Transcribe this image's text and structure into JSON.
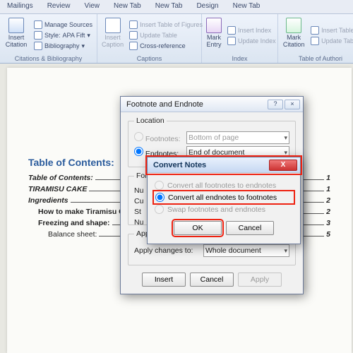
{
  "ribbon": {
    "tabs": [
      "Mailings",
      "Review",
      "View",
      "New Tab",
      "New Tab",
      "Design",
      "New Tab"
    ],
    "citations_group": {
      "insert_citation": "Insert Citation",
      "manage_sources": "Manage Sources",
      "style_label": "Style:",
      "style_value": "APA Fift",
      "bibliography": "Bibliography",
      "label": "Citations & Bibliography"
    },
    "captions_group": {
      "insert_caption": "Insert Caption",
      "tof": "Insert Table of Figures",
      "update": "Update Table",
      "crossref": "Cross-reference",
      "label": "Captions"
    },
    "index_group": {
      "mark_entry": "Mark Entry",
      "insert_index": "Insert Index",
      "update_index": "Update Index",
      "label": "Index"
    },
    "toa_group": {
      "mark_citation": "Mark Citation",
      "insert_toa": "Insert Table",
      "update_toa": "Update Table",
      "label": "Table of Authori"
    }
  },
  "document": {
    "toc_title": "Table of Contents:",
    "lines": [
      {
        "label": "Table of Contents:",
        "page": "1",
        "cls": "bold ital"
      },
      {
        "label": "TIRAMISU CAKE",
        "page": "1",
        "cls": "bold ital"
      },
      {
        "label": "Ingredients",
        "page": "2",
        "cls": "bold ital"
      },
      {
        "label": "How to make Tiramisu C",
        "page": "2",
        "cls": "bold indent1"
      },
      {
        "label": "Freezing and shape:",
        "page": "3",
        "cls": "bold indent1"
      },
      {
        "label": "Balance sheet:",
        "page": "5",
        "cls": "indent2"
      }
    ]
  },
  "dialog_footnote": {
    "title": "Footnote and Endnote",
    "location_legend": "Location",
    "footnotes_label": "Footnotes:",
    "footnotes_value": "Bottom of page",
    "endnotes_label": "Endnotes:",
    "endnotes_value": "End of document",
    "format_legend": "Form",
    "num_label": "Nu",
    "cu_label": "Cu",
    "st_label": "St",
    "nu2_label": "Nu",
    "apply_legend": "Apply changes",
    "apply_to_label": "Apply changes to:",
    "apply_to_value": "Whole document",
    "insert_btn": "Insert",
    "cancel_btn": "Cancel",
    "apply_btn": "Apply"
  },
  "dialog_convert": {
    "title": "Convert Notes",
    "opt1": "Convert all footnotes to endnotes",
    "opt2": "Convert all endnotes to footnotes",
    "opt3": "Swap footnotes and endnotes",
    "ok_btn": "OK",
    "cancel_btn": "Cancel"
  }
}
